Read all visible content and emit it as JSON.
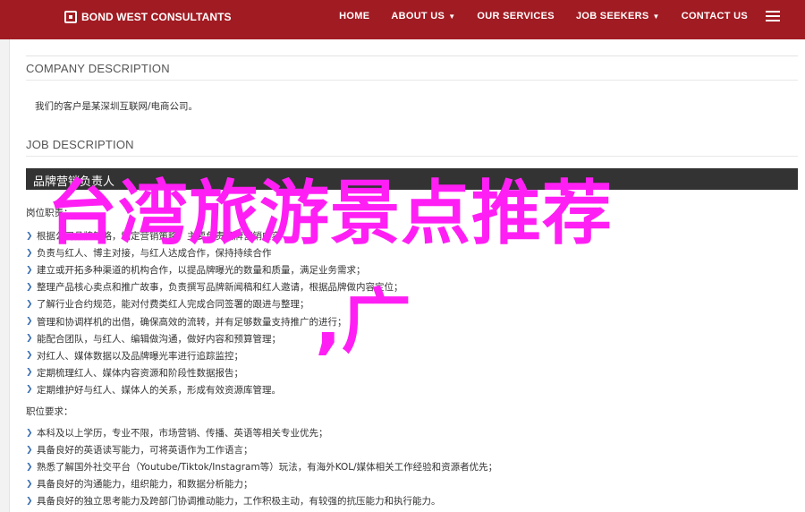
{
  "header": {
    "logo_text": "BOND WEST CONSULTANTS",
    "nav": [
      {
        "label": "HOME",
        "has_dropdown": false
      },
      {
        "label": "ABOUT US",
        "has_dropdown": true
      },
      {
        "label": "OUR SERVICES",
        "has_dropdown": false
      },
      {
        "label": "JOB SEEKERS",
        "has_dropdown": true
      },
      {
        "label": "CONTACT US",
        "has_dropdown": false
      }
    ],
    "background_color": "#a11b22"
  },
  "company": {
    "title": "COMPANY DESCRIPTION",
    "text": "我们的客户是某深圳互联网/电商公司。"
  },
  "job": {
    "title": "JOB DESCRIPTION",
    "position_title": "品牌营销负责人",
    "duties_label": "岗位职责：",
    "duties": [
      "根据公司品牌策略，制定营销策略，主要负责品牌营销内容",
      "负责与红人、博主对接，与红人达成合作，保持持续合作",
      "建立或开拓多种渠道的机构合作，以提品牌曝光的数量和质量，满足业务需求；",
      "整理产品核心卖点和推广故事，负责撰写品牌新闻稿和红人邀请，根据品牌做内容定位；",
      "了解行业合约规范，能对付费类红人完成合同签署的跟进与整理；",
      "管理和协调样机的出借，确保高效的流转，并有足够数量支持推广的进行；",
      "能配合团队，与红人、编辑做沟通，做好内容和预算管理；",
      "对红人、媒体数据以及品牌曝光率进行追踪监控；",
      "定期梳理红人、媒体内容资源和阶段性数据报告；",
      "定期维护好与红人、媒体人的关系，形成有效资源库管理。"
    ],
    "requirements_label": "职位要求：",
    "requirements": [
      "本科及以上学历，专业不限，市场营销、传播、英语等相关专业优先；",
      "具备良好的英语读写能力，可将英语作为工作语言；",
      "熟悉了解国外社交平台（Youtube/Tiktok/Instagram等）玩法，有海外KOL/媒体相关工作经验和资源者优先；",
      "具备良好的沟通能力，组织能力，和数据分析能力；",
      "具备良好的独立思考能力及跨部门协调推动能力，工作积极主动，有较强的抗压能力和执行能力。"
    ]
  },
  "overlay": {
    "line1": "台湾旅游景点推荐",
    "line2": ",广",
    "color": "#ff1ff4"
  }
}
